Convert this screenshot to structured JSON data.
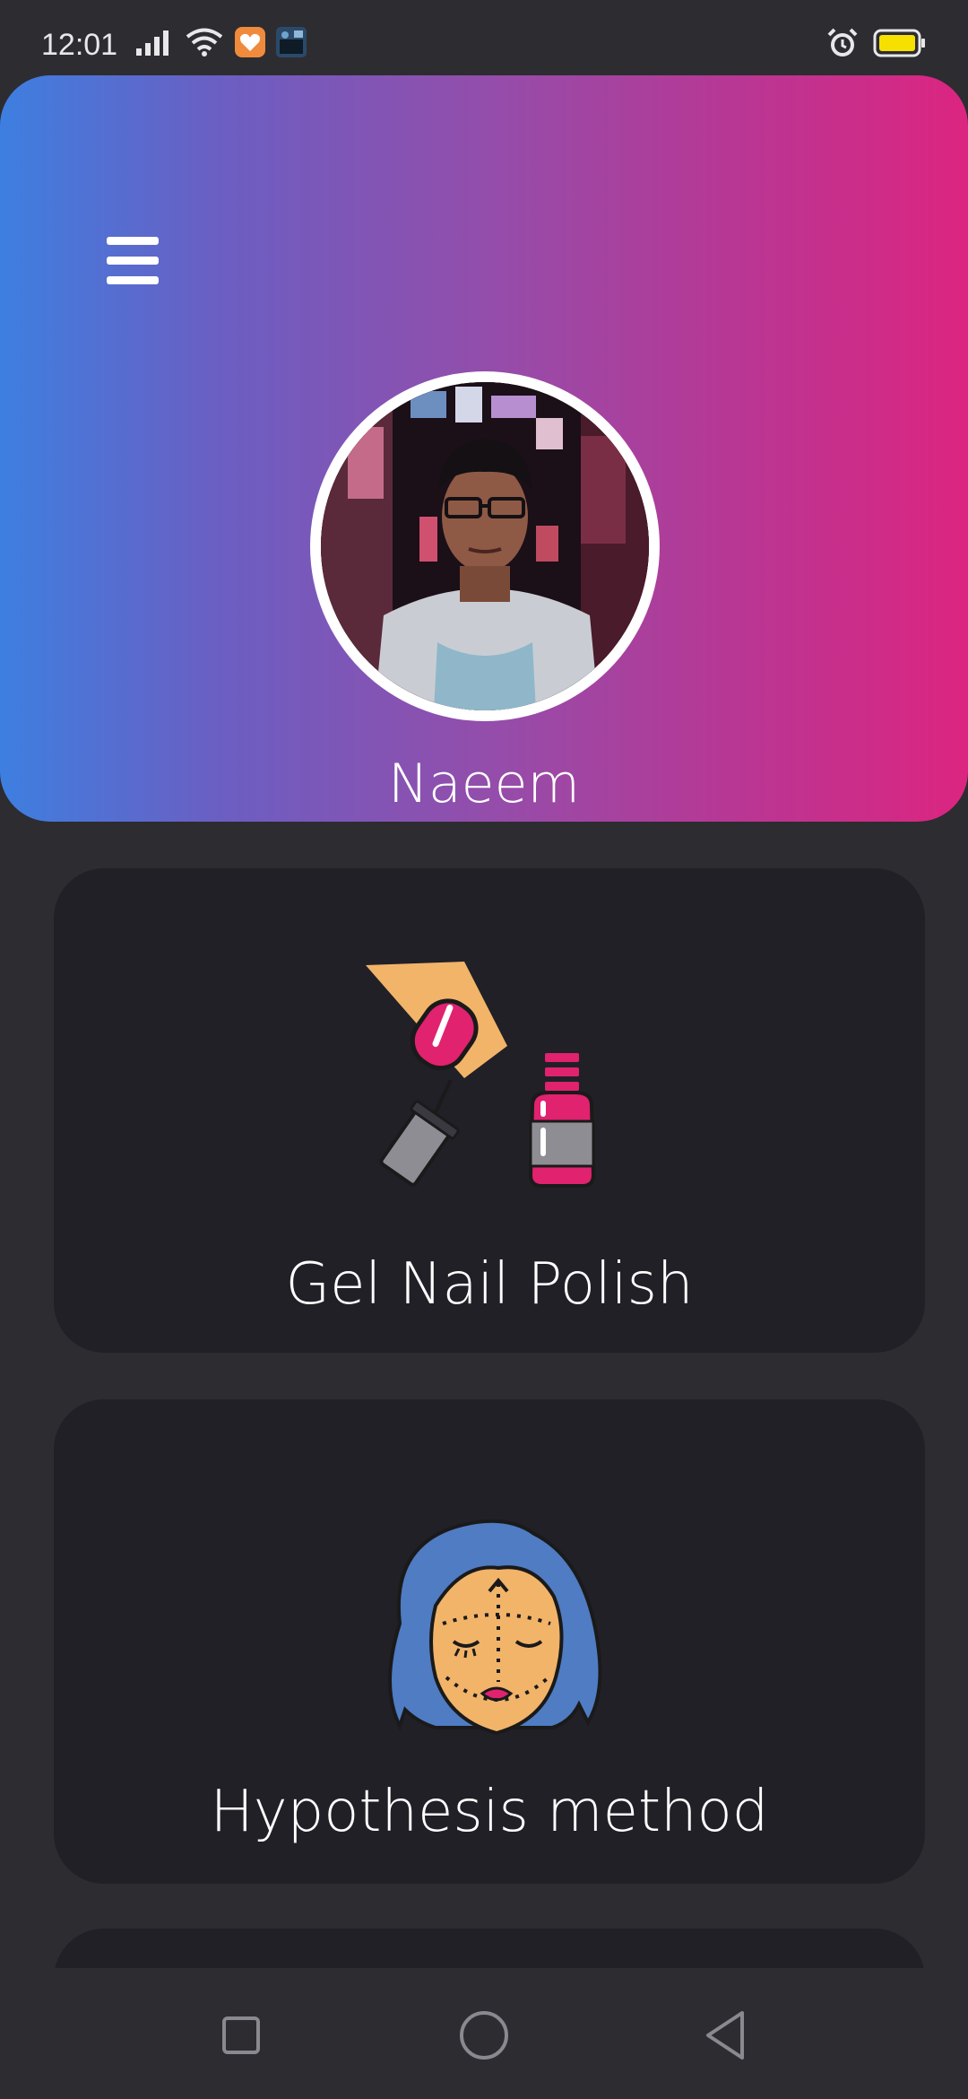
{
  "status_bar": {
    "time": "12:01",
    "icons": [
      "signal-icon",
      "wifi-icon",
      "health-app-icon",
      "gallery-app-icon",
      "alarm-icon",
      "battery-icon"
    ],
    "battery_color": "#f5e000"
  },
  "header": {
    "gradient": [
      "#3d7fe0",
      "#964ca9",
      "#dc2580"
    ],
    "menu_icon": "hamburger-menu-icon",
    "profile_name": "Naeem"
  },
  "categories": [
    {
      "label": "Gel Nail Polish",
      "icon": "nail-polish-icon"
    },
    {
      "label": "Hypothesis method",
      "icon": "face-surgery-icon"
    }
  ],
  "nav_bar": {
    "buttons": [
      "recent-apps-icon",
      "home-icon",
      "back-icon"
    ]
  }
}
